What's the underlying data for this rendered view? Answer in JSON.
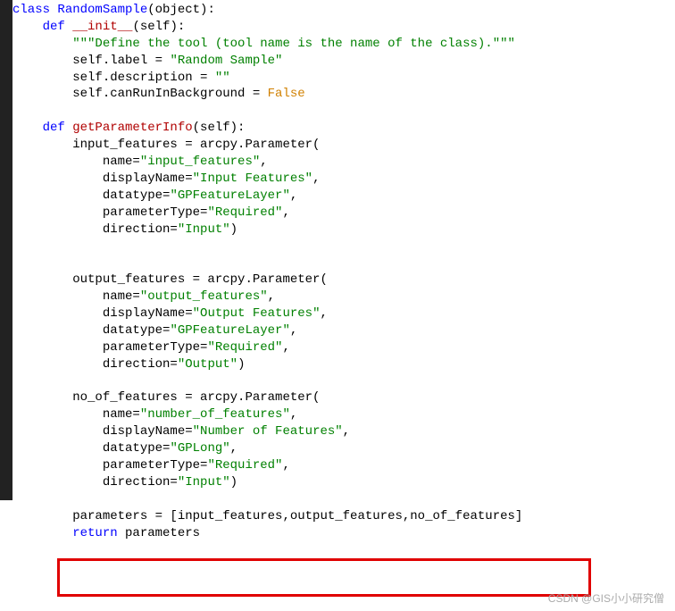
{
  "code": {
    "l01_kw": "class",
    "l01_name": " RandomSample",
    "l01_rest": "(object):",
    "l02_kw": "    def",
    "l02_meth": " __init__",
    "l02_rest": "(self):",
    "l03_doc": "        \"\"\"Define the tool (tool name is the name of the class).\"\"\"",
    "l04a": "        self.label = ",
    "l04s": "\"Random Sample\"",
    "l05a": "        self.description = ",
    "l05s": "\"\"",
    "l06a": "        self.canRunInBackground = ",
    "l06c": "False",
    "l08_kw": "    def",
    "l08_meth": " getParameterInfo",
    "l08_rest": "(self):",
    "l09": "        input_features = arcpy.Parameter(",
    "l10a": "            name=",
    "l10s": "\"input_features\"",
    "l10c": ",",
    "l11a": "            displayName=",
    "l11s": "\"Input Features\"",
    "l11c": ",",
    "l12a": "            datatype=",
    "l12s": "\"GPFeatureLayer\"",
    "l12c": ",",
    "l13a": "            parameterType=",
    "l13s": "\"Required\"",
    "l13c": ",",
    "l14a": "            direction=",
    "l14s": "\"Input\"",
    "l14c": ")",
    "l17": "        output_features = arcpy.Parameter(",
    "l18a": "            name=",
    "l18s": "\"output_features\"",
    "l18c": ",",
    "l19a": "            displayName=",
    "l19s": "\"Output Features\"",
    "l19c": ",",
    "l20a": "            datatype=",
    "l20s": "\"GPFeatureLayer\"",
    "l20c": ",",
    "l21a": "            parameterType=",
    "l21s": "\"Required\"",
    "l21c": ",",
    "l22a": "            direction=",
    "l22s": "\"Output\"",
    "l22c": ")",
    "l24": "        no_of_features = arcpy.Parameter(",
    "l25a": "            name=",
    "l25s": "\"number_of_features\"",
    "l25c": ",",
    "l26a": "            displayName=",
    "l26s": "\"Number of Features\"",
    "l26c": ",",
    "l27a": "            datatype=",
    "l27s": "\"GPLong\"",
    "l27c": ",",
    "l28a": "            parameterType=",
    "l28s": "\"Required\"",
    "l28c": ",",
    "l29a": "            direction=",
    "l29s": "\"Input\"",
    "l29c": ")",
    "l31": "        parameters = [input_features,output_features,no_of_features]",
    "l32_kw": "        return",
    "l32_rest": " parameters"
  },
  "watermark": "CSDN @GIS小小研究僧"
}
